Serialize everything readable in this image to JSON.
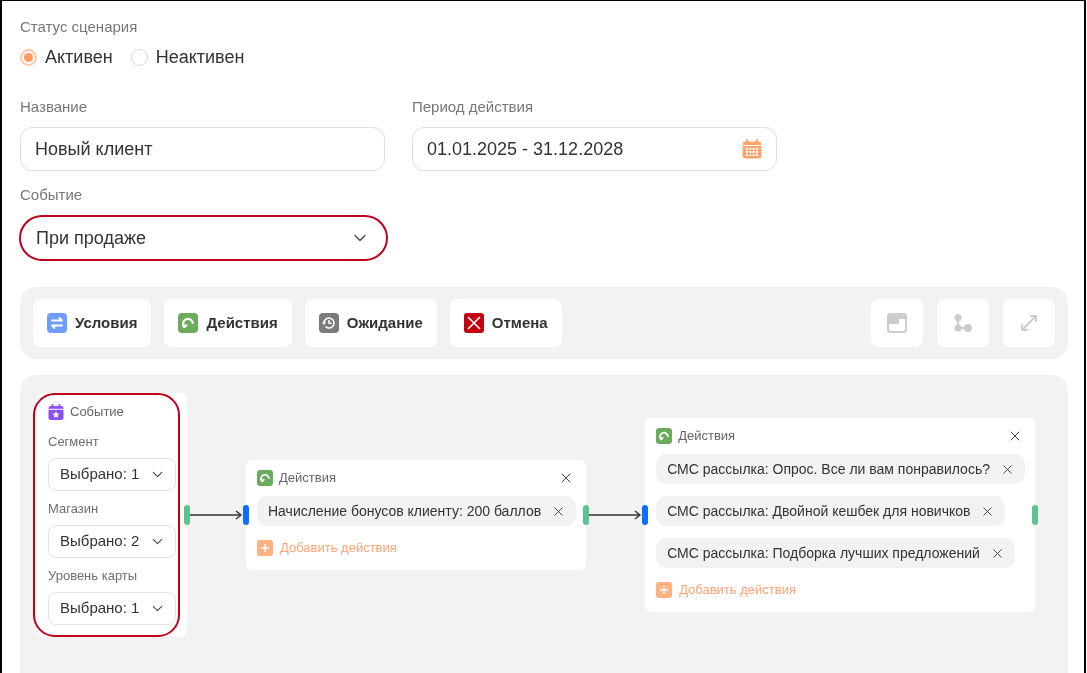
{
  "status": {
    "label": "Статус сценария",
    "options": [
      {
        "label": "Активен",
        "selected": true
      },
      {
        "label": "Неактивен",
        "selected": false
      }
    ]
  },
  "fields": [
    {
      "kind": "text",
      "label": "Название",
      "value": "Новый клиент"
    },
    {
      "kind": "date",
      "label": "Период действия",
      "value": "01.01.2025 - 31.12.2028"
    }
  ],
  "event": {
    "label": "Событие",
    "value": "При продаже",
    "highlighted": true
  },
  "toolbar": {
    "buttons": [
      {
        "kind": "conditions",
        "label": "Условия"
      },
      {
        "kind": "actions",
        "label": "Действия"
      },
      {
        "kind": "wait",
        "label": "Ожидание"
      },
      {
        "kind": "cancel",
        "label": "Отмена"
      }
    ],
    "tools": [
      {
        "kind": "layout",
        "disabled": true
      },
      {
        "kind": "nodes",
        "disabled": true
      },
      {
        "kind": "expand",
        "disabled": true
      }
    ]
  },
  "canvas": {
    "nodes": [
      {
        "kind": "event",
        "title": "Событие",
        "highlighted": true,
        "fields": [
          {
            "label": "Сегмент",
            "value": "Выбрано: 1"
          },
          {
            "label": "Магазин",
            "value": "Выбрано: 2"
          },
          {
            "label": "Уровень карты",
            "value": "Выбрано: 1"
          }
        ]
      },
      {
        "kind": "actions",
        "title": "Действия",
        "items": [
          "Начисление бонусов клиенту: 200 баллов"
        ],
        "add_label": "Добавить действия"
      },
      {
        "kind": "actions",
        "title": "Действия",
        "items": [
          "СМС рассылка: Опрос. Все ли вам понравилось?",
          "СМС рассылка: Двойной кешбек для новичков",
          "СМС рассылка: Подборка лучших предложений"
        ],
        "add_label": "Добавить действия"
      }
    ]
  }
}
